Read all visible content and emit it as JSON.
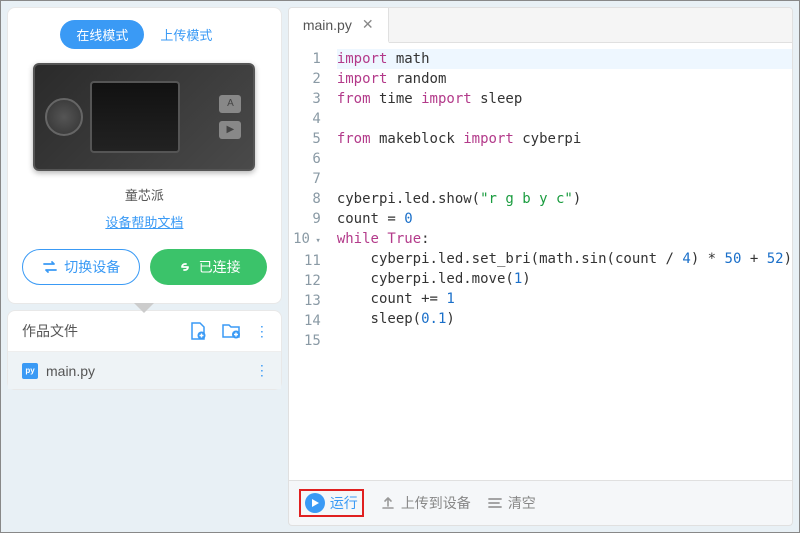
{
  "modeTabs": {
    "online": "在线模式",
    "upload": "上传模式"
  },
  "device": {
    "name": "童芯派",
    "helpLink": "设备帮助文档",
    "switch": "切换设备",
    "connected": "已连接"
  },
  "files": {
    "title": "作品文件",
    "current": "main.py"
  },
  "tab": {
    "name": "main.py"
  },
  "code": {
    "lines": [
      {
        "n": "1",
        "html": "<span class='kw'>import</span> math"
      },
      {
        "n": "2",
        "html": "<span class='kw'>import</span> random"
      },
      {
        "n": "3",
        "html": "<span class='kw'>from</span> time <span class='kw'>import</span> sleep"
      },
      {
        "n": "4",
        "html": ""
      },
      {
        "n": "5",
        "html": "<span class='kw'>from</span> makeblock <span class='kw'>import</span> cyberpi"
      },
      {
        "n": "6",
        "html": ""
      },
      {
        "n": "7",
        "html": ""
      },
      {
        "n": "8",
        "html": "cyberpi.led.show(<span class='str'>\"r g b y c\"</span>)"
      },
      {
        "n": "9",
        "html": "count = <span class='num'>0</span>"
      },
      {
        "n": "10",
        "fold": true,
        "html": "<span class='kw'>while</span> <span class='kw'>True</span>:"
      },
      {
        "n": "11",
        "html": "    cyberpi.led.set_bri(math.sin(count / <span class='num'>4</span>) * <span class='num'>50</span> + <span class='num'>52</span>)"
      },
      {
        "n": "12",
        "html": "    cyberpi.led.move(<span class='num'>1</span>)"
      },
      {
        "n": "13",
        "html": "    count += <span class='num'>1</span>"
      },
      {
        "n": "14",
        "html": "    sleep(<span class='num'>0.1</span>)"
      },
      {
        "n": "15",
        "html": ""
      }
    ]
  },
  "bottomBar": {
    "run": "运行",
    "upload": "上传到设备",
    "clear": "清空"
  }
}
